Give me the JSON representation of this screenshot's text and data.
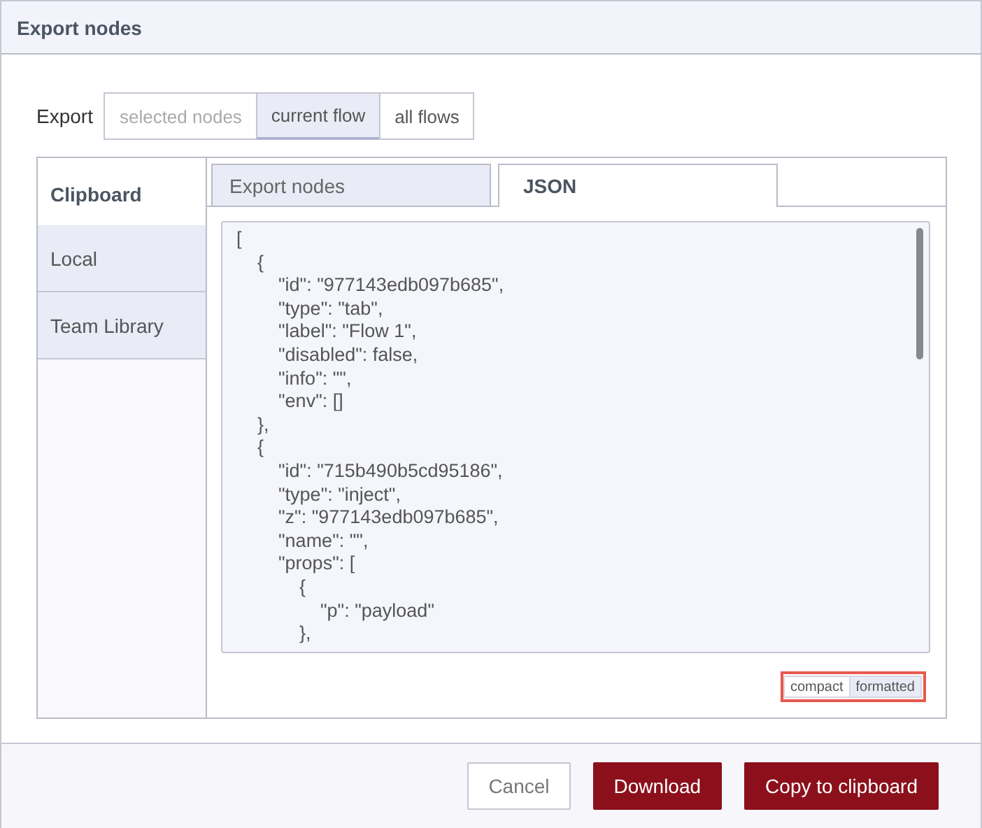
{
  "dialog": {
    "title": "Export nodes"
  },
  "export_scope": {
    "label": "Export",
    "options": [
      {
        "label": "selected nodes",
        "selected": false,
        "disabled": true
      },
      {
        "label": "current flow",
        "selected": true,
        "disabled": false
      },
      {
        "label": "all flows",
        "selected": false,
        "disabled": false
      }
    ]
  },
  "sidebar": {
    "items": [
      {
        "label": "Clipboard",
        "selected": true
      },
      {
        "label": "Local",
        "selected": false
      },
      {
        "label": "Team Library",
        "selected": false
      }
    ]
  },
  "tabs": [
    {
      "label": "Export nodes",
      "selected": false
    },
    {
      "label": "JSON",
      "selected": true
    }
  ],
  "json_field": {
    "value": "[\n    {\n        \"id\": \"977143edb097b685\",\n        \"type\": \"tab\",\n        \"label\": \"Flow 1\",\n        \"disabled\": false,\n        \"info\": \"\",\n        \"env\": []\n    },\n    {\n        \"id\": \"715b490b5cd95186\",\n        \"type\": \"inject\",\n        \"z\": \"977143edb097b685\",\n        \"name\": \"\",\n        \"props\": [\n            {\n                \"p\": \"payload\"\n            },"
  },
  "format_toggle": [
    {
      "label": "compact",
      "selected": false
    },
    {
      "label": "formatted",
      "selected": true
    }
  ],
  "buttons": [
    {
      "label": "Cancel",
      "kind": "secondary"
    },
    {
      "label": "Download",
      "kind": "primary"
    },
    {
      "label": "Copy to clipboard",
      "kind": "primary"
    }
  ]
}
